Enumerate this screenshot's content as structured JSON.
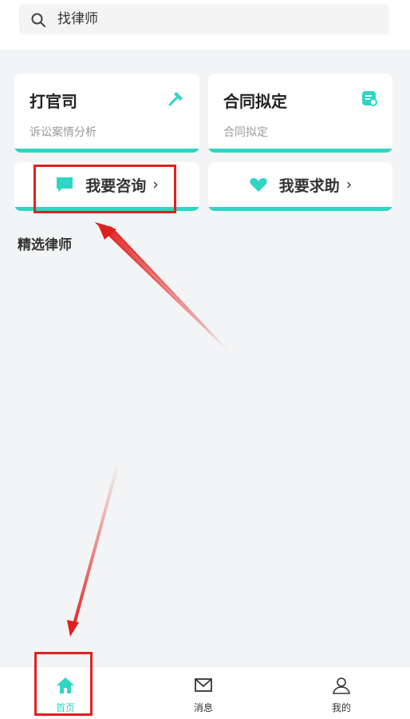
{
  "search": {
    "text": "找律师"
  },
  "cards": [
    {
      "title": "打官司",
      "subtitle": "诉讼案情分析",
      "icon": "hammer-icon"
    },
    {
      "title": "合同拟定",
      "subtitle": "合同拟定",
      "icon": "document-icon"
    }
  ],
  "actions": [
    {
      "label": "我要咨询",
      "arrow": "›",
      "icon": "chat-bubble-icon"
    },
    {
      "label": "我要求助",
      "arrow": "›",
      "icon": "heart-icon"
    }
  ],
  "section": {
    "title": "精选律师"
  },
  "tabs": [
    {
      "label": "首页",
      "icon": "home-icon",
      "active": true
    },
    {
      "label": "消息",
      "icon": "mail-icon",
      "active": false
    },
    {
      "label": "我的",
      "icon": "user-icon",
      "active": false
    }
  ],
  "colors": {
    "accent": "#2fd6c4",
    "annotation": "#e02020",
    "background": "#f3f4f5"
  }
}
